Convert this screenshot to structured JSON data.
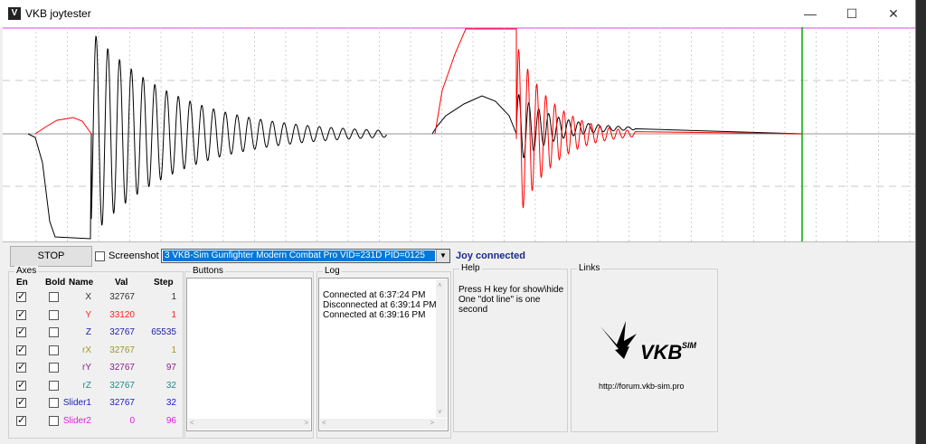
{
  "window": {
    "title": "VKB joytester",
    "icon": "vkb-app-icon"
  },
  "controls": {
    "stop_label": "STOP",
    "screenshot_label": "Screenshot",
    "screenshot_checked": false,
    "device_selected": "3  VKB-Sim Gunfighter Modern Combat Pro  VID=231D PID=0125",
    "status": "Joy connected"
  },
  "axes": {
    "group_label": "Axes",
    "headers": {
      "en": "En",
      "bold": "Bold",
      "name": "Name",
      "val": "Val",
      "step": "Step"
    },
    "rows": [
      {
        "name": "X",
        "val": "32767",
        "step": "1",
        "color": "#303030",
        "en": true,
        "bold": false
      },
      {
        "name": "Y",
        "val": "33120",
        "step": "1",
        "color": "#ff2020",
        "en": true,
        "bold": false
      },
      {
        "name": "Z",
        "val": "32767",
        "step": "65535",
        "color": "#2020a0",
        "en": true,
        "bold": false
      },
      {
        "name": "rX",
        "val": "32767",
        "step": "1",
        "color": "#9a9a20",
        "en": true,
        "bold": false
      },
      {
        "name": "rY",
        "val": "32767",
        "step": "97",
        "color": "#8a208a",
        "en": true,
        "bold": false
      },
      {
        "name": "rZ",
        "val": "32767",
        "step": "32",
        "color": "#208a8a",
        "en": true,
        "bold": false
      },
      {
        "name": "Slider1",
        "val": "32767",
        "step": "32",
        "color": "#2020c0",
        "en": true,
        "bold": false
      },
      {
        "name": "Slider2",
        "val": "0",
        "step": "96",
        "color": "#e020e0",
        "en": true,
        "bold": false
      }
    ]
  },
  "buttons_group": {
    "label": "Buttons"
  },
  "log": {
    "label": "Log",
    "lines": [
      "Connected at 6:37:24 PM",
      "Disconnected at 6:39:14 PM",
      "Connected at 6:39:16 PM"
    ]
  },
  "help": {
    "label": "Help",
    "lines": [
      "Press H key for show\\hide",
      "One \"dot line\" is one second"
    ]
  },
  "links": {
    "label": "Links",
    "logo_text": "VKB",
    "logo_sup": "SIM",
    "url": "http://forum.vkb-sim.pro"
  },
  "plot_colors": {
    "x": "#000000",
    "y": "#ff0000",
    "cursor": "#00aa00",
    "top_line": "#e040e0",
    "grid": "#c8c8c8"
  }
}
